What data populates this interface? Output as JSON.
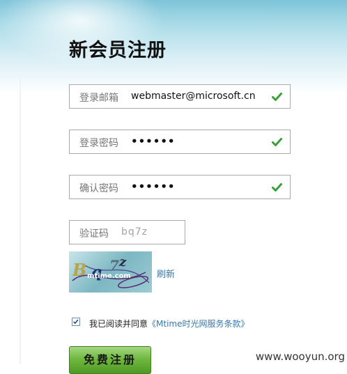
{
  "form": {
    "title": "新会员注册",
    "email": {
      "label": "登录邮箱",
      "value": "webmaster@microsoft.cn"
    },
    "password": {
      "label": "登录密码",
      "value": "••••••"
    },
    "confirm": {
      "label": "确认密码",
      "value": "••••••"
    },
    "captcha": {
      "label": "验证码",
      "value": "bq7z",
      "image_text": "mtime.com",
      "refresh_label": "刷新"
    },
    "agree": {
      "checked": true,
      "text": "我已阅读并同意",
      "link_text": "《Mtime时光网服务条款》"
    },
    "submit_label": "免费注册"
  },
  "watermark": "www.wooyun.org"
}
